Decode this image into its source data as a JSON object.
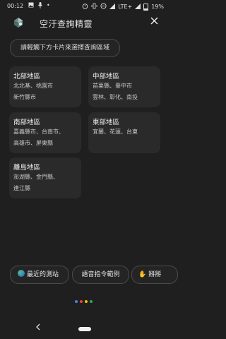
{
  "status_bar": {
    "time": "00:12",
    "network": "LTE+",
    "battery": "19%",
    "icons": [
      "image-icon",
      "mic-icon",
      "alarm-icon",
      "vibrate-icon",
      "dnd-icon",
      "signal-icon",
      "battery-icon"
    ]
  },
  "header": {
    "title": "空汙查詢精靈",
    "close_icon": "close-icon"
  },
  "hint": "請輕觸下方卡片來選擇查詢區域",
  "regions": [
    {
      "title": "北部地區",
      "lines": [
        "北北基、桃園市",
        "新竹縣市"
      ]
    },
    {
      "title": "中部地區",
      "lines": [
        "苗栗縣、臺中市",
        "雲林、彰化、南投"
      ]
    },
    {
      "title": "南部地區",
      "lines": [
        "嘉義縣市、台南市、",
        "高雄市、屏東縣"
      ]
    },
    {
      "title": "東部地區",
      "lines": [
        "宜蘭、花蓮、台東"
      ]
    },
    {
      "title": "離島地區",
      "lines": [
        "澎湖縣、金門縣、",
        "連江縣"
      ]
    }
  ],
  "suggestions": [
    {
      "label": "最近的測站",
      "icon": "globe-icon"
    },
    {
      "label": "語音指令範例",
      "icon": ""
    },
    {
      "label": "掰掰",
      "icon": "wave-hand-icon"
    }
  ],
  "colors": {
    "background": "#1f1f1f",
    "card": "#2a2a2a",
    "dot_blue": "#4285f4",
    "dot_red": "#ea4335",
    "dot_yellow": "#fbbc05",
    "dot_green": "#34a853"
  }
}
